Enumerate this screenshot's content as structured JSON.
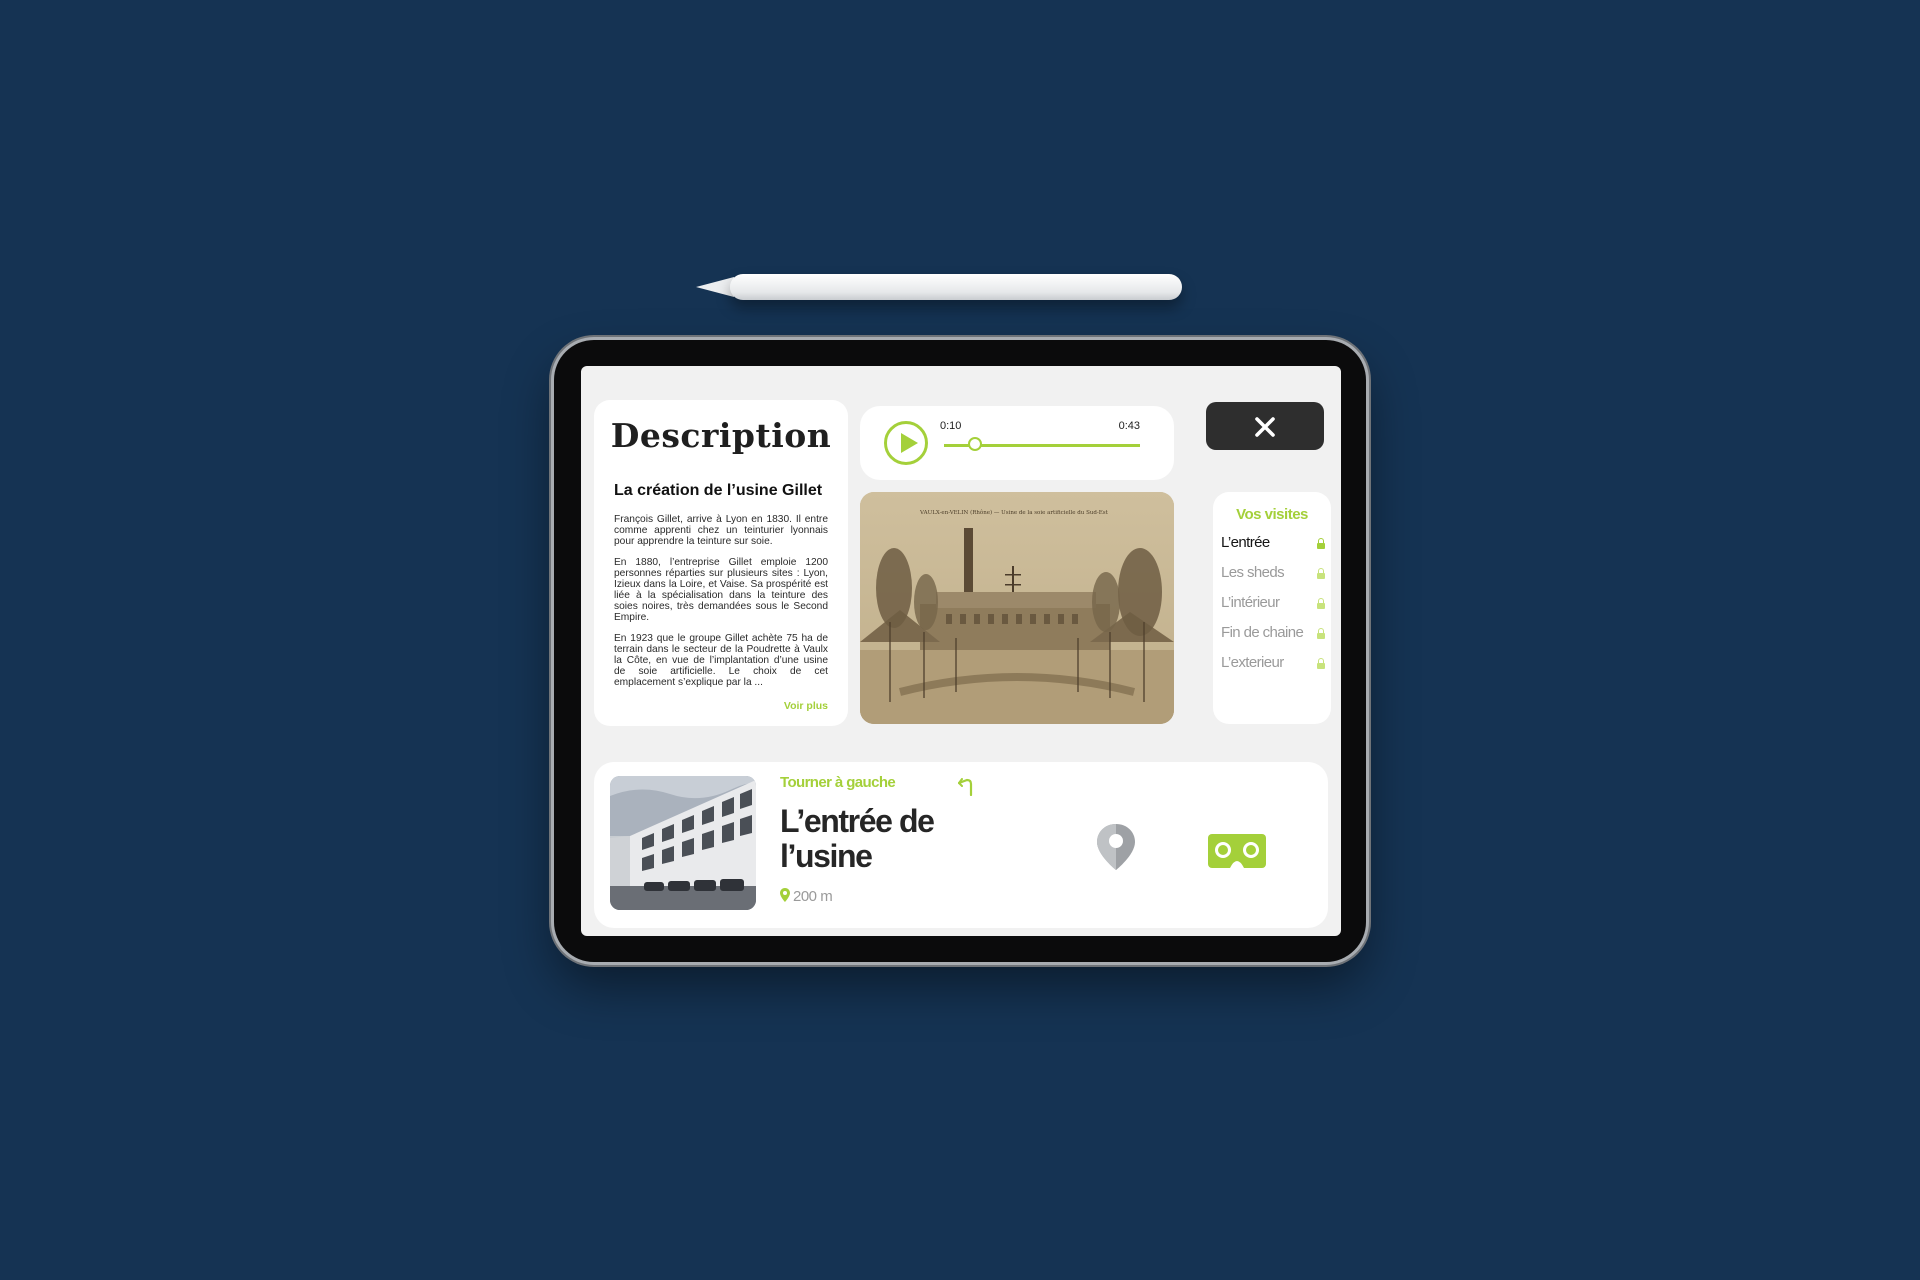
{
  "description": {
    "title": "Description",
    "subtitle": "La création de l’usine Gillet",
    "paragraphs": [
      "François Gillet, arrive à Lyon en 1830. Il entre comme apprenti chez un teinturier lyonnais pour apprendre la teinture sur soie.",
      "En 1880, l’entreprise Gillet emploie 1200 personnes réparties sur plusieurs sites : Lyon, Izieux dans la Loire, et Vaise. Sa prospérité est liée à la spécialisation dans la teinture des soies noires, très demandées sous le Second Empire.",
      "En 1923 que le groupe Gillet achète 75 ha de terrain dans le secteur de la Poudrette à Vaulx la Côte, en vue de l’implantation d’une usine de soie artificielle. Le choix de cet emplacement s’explique par la ..."
    ],
    "more_label": "Voir plus"
  },
  "audio": {
    "current_time": "0:10",
    "total_time": "0:43",
    "progress": 0.16
  },
  "photo": {
    "caption": "VAULX-en-VELIN (Rhône) — Usine de la soie artificielle du Sud-Est"
  },
  "close": {
    "icon": "close-icon"
  },
  "visits": {
    "title": "Vos visites",
    "items": [
      {
        "label": "L’entrée",
        "active": true
      },
      {
        "label": "Les sheds",
        "active": false
      },
      {
        "label": "L’intérieur",
        "active": false
      },
      {
        "label": "Fin de chaine",
        "active": false
      },
      {
        "label": "L’exterieur",
        "active": false
      }
    ]
  },
  "navigation": {
    "instruction": "Tourner à gauche",
    "title": "L’entrée de l’usine",
    "distance": "200 m"
  },
  "colors": {
    "accent": "#a4d03a",
    "background": "#153353",
    "dark": "#2e2e2e"
  }
}
